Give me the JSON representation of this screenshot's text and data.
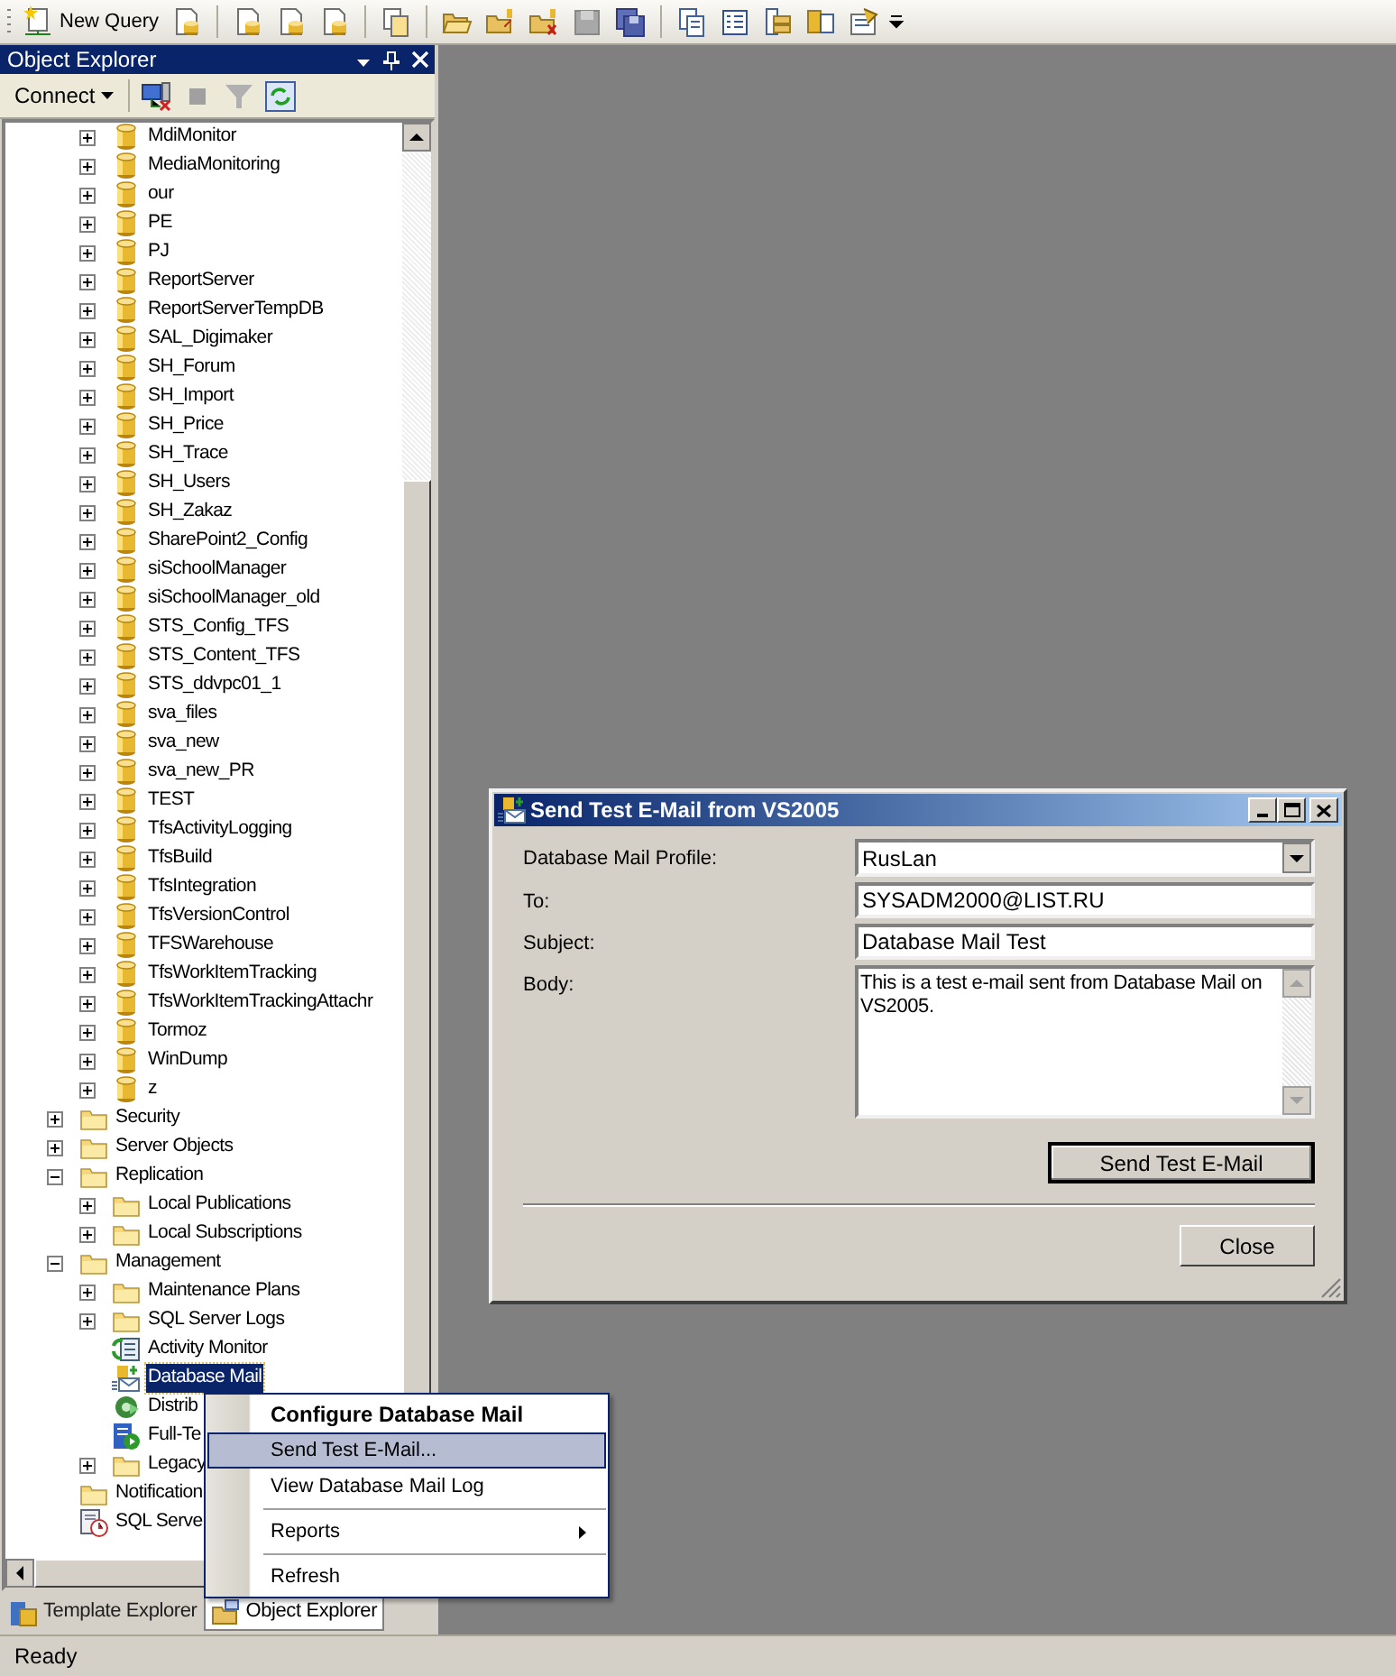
{
  "toolbar": {
    "new_query": "New Query"
  },
  "object_explorer": {
    "title": "Object Explorer",
    "connect": "Connect",
    "databases": [
      {
        "label": "MdiMonitor",
        "expanded": false,
        "selected": false
      },
      {
        "label": "MediaMonitoring",
        "expanded": false,
        "selected": false
      },
      {
        "label": "our",
        "expanded": false,
        "selected": false
      },
      {
        "label": "PE",
        "expanded": false,
        "selected": false
      },
      {
        "label": "PJ",
        "expanded": false,
        "selected": false
      },
      {
        "label": "ReportServer",
        "expanded": false,
        "selected": false
      },
      {
        "label": "ReportServerTempDB",
        "expanded": false,
        "selected": false
      },
      {
        "label": "SAL_Digimaker",
        "expanded": false,
        "selected": false
      },
      {
        "label": "SH_Forum",
        "expanded": false,
        "selected": false
      },
      {
        "label": "SH_Import",
        "expanded": false,
        "selected": false
      },
      {
        "label": "SH_Price",
        "expanded": false,
        "selected": false
      },
      {
        "label": "SH_Trace",
        "expanded": false,
        "selected": false
      },
      {
        "label": "SH_Users",
        "expanded": false,
        "selected": false
      },
      {
        "label": "SH_Zakaz",
        "expanded": false,
        "selected": false
      },
      {
        "label": "SharePoint2_Config",
        "expanded": false,
        "selected": false
      },
      {
        "label": "siSchoolManager",
        "expanded": false,
        "selected": false
      },
      {
        "label": "siSchoolManager_old",
        "expanded": false,
        "selected": false
      },
      {
        "label": "STS_Config_TFS",
        "expanded": false,
        "selected": false
      },
      {
        "label": "STS_Content_TFS",
        "expanded": false,
        "selected": false
      },
      {
        "label": "STS_ddvpc01_1",
        "expanded": false,
        "selected": false
      },
      {
        "label": "sva_files",
        "expanded": false,
        "selected": false
      },
      {
        "label": "sva_new",
        "expanded": false,
        "selected": false
      },
      {
        "label": "sva_new_PR",
        "expanded": false,
        "selected": false
      },
      {
        "label": "TEST",
        "expanded": false,
        "selected": false
      },
      {
        "label": "TfsActivityLogging",
        "expanded": false,
        "selected": false
      },
      {
        "label": "TfsBuild",
        "expanded": false,
        "selected": false
      },
      {
        "label": "TfsIntegration",
        "expanded": false,
        "selected": false
      },
      {
        "label": "TfsVersionControl",
        "expanded": false,
        "selected": false
      },
      {
        "label": "TFSWarehouse",
        "expanded": false,
        "selected": false
      },
      {
        "label": "TfsWorkItemTracking",
        "expanded": false,
        "selected": false
      },
      {
        "label": "TfsWorkItemTrackingAttachr",
        "expanded": false,
        "selected": false
      },
      {
        "label": "Tormoz",
        "expanded": false,
        "selected": false
      },
      {
        "label": "WinDump",
        "expanded": false,
        "selected": false
      },
      {
        "label": "z",
        "expanded": false,
        "selected": false
      }
    ],
    "nodes": [
      {
        "label": "Security",
        "kind": "folder",
        "expanded": false,
        "selected": false
      },
      {
        "label": "Server Objects",
        "kind": "folder",
        "expanded": false,
        "selected": false
      },
      {
        "label": "Replication",
        "kind": "folder",
        "expanded": true,
        "selected": false,
        "children": [
          {
            "label": "Local Publications",
            "kind": "folder",
            "expanded": false,
            "selected": false
          },
          {
            "label": "Local Subscriptions",
            "kind": "folder",
            "expanded": false,
            "selected": false
          }
        ]
      },
      {
        "label": "Management",
        "kind": "folder",
        "expanded": true,
        "selected": false,
        "children": [
          {
            "label": "Maintenance Plans",
            "kind": "folder",
            "expanded": false,
            "selected": false
          },
          {
            "label": "SQL Server Logs",
            "kind": "folder",
            "expanded": false,
            "selected": false
          },
          {
            "label": "Activity Monitor",
            "kind": "monitor",
            "selected": false
          },
          {
            "label": "Database Mail",
            "kind": "mail",
            "selected": true
          },
          {
            "label": "Distrib",
            "kind": "distributor",
            "selected": false
          },
          {
            "label": "Full-Te",
            "kind": "fulltext",
            "selected": false
          },
          {
            "label": "Legacy",
            "kind": "folder",
            "expanded": false,
            "selected": false
          }
        ]
      },
      {
        "label": "Notification",
        "kind": "folder",
        "selected": false
      },
      {
        "label": "SQL Serve",
        "kind": "agent",
        "selected": false
      }
    ]
  },
  "bottom_tabs": [
    {
      "label": "Template Explorer",
      "selected": false
    },
    {
      "label": "Object Explorer",
      "selected": true
    }
  ],
  "status_bar": "Ready",
  "context_menu": [
    {
      "kind": "item",
      "label": "Configure Database Mail",
      "default": true,
      "selected": false,
      "submenu": false
    },
    {
      "kind": "item",
      "label": "Send Test E-Mail...",
      "default": false,
      "selected": true,
      "submenu": false
    },
    {
      "kind": "item",
      "label": "View Database Mail Log",
      "default": false,
      "selected": false,
      "submenu": false
    },
    {
      "kind": "separator"
    },
    {
      "kind": "item",
      "label": "Reports",
      "default": false,
      "selected": false,
      "submenu": true
    },
    {
      "kind": "separator"
    },
    {
      "kind": "item",
      "label": "Refresh",
      "default": false,
      "selected": false,
      "submenu": false
    }
  ],
  "dialog": {
    "title": "Send Test E-Mail from VS2005",
    "profile": {
      "label": "Database Mail Profile:",
      "value": "RusLan"
    },
    "to": {
      "label": "To:",
      "value": "SYSADM2000@LIST.RU"
    },
    "subject": {
      "label": "Subject:",
      "value": "Database Mail Test"
    },
    "body": {
      "label": "Body:",
      "value": "This is a test e-mail sent from Database Mail on VS2005."
    },
    "send_button": "Send Test E-Mail",
    "close_button": "Close"
  }
}
